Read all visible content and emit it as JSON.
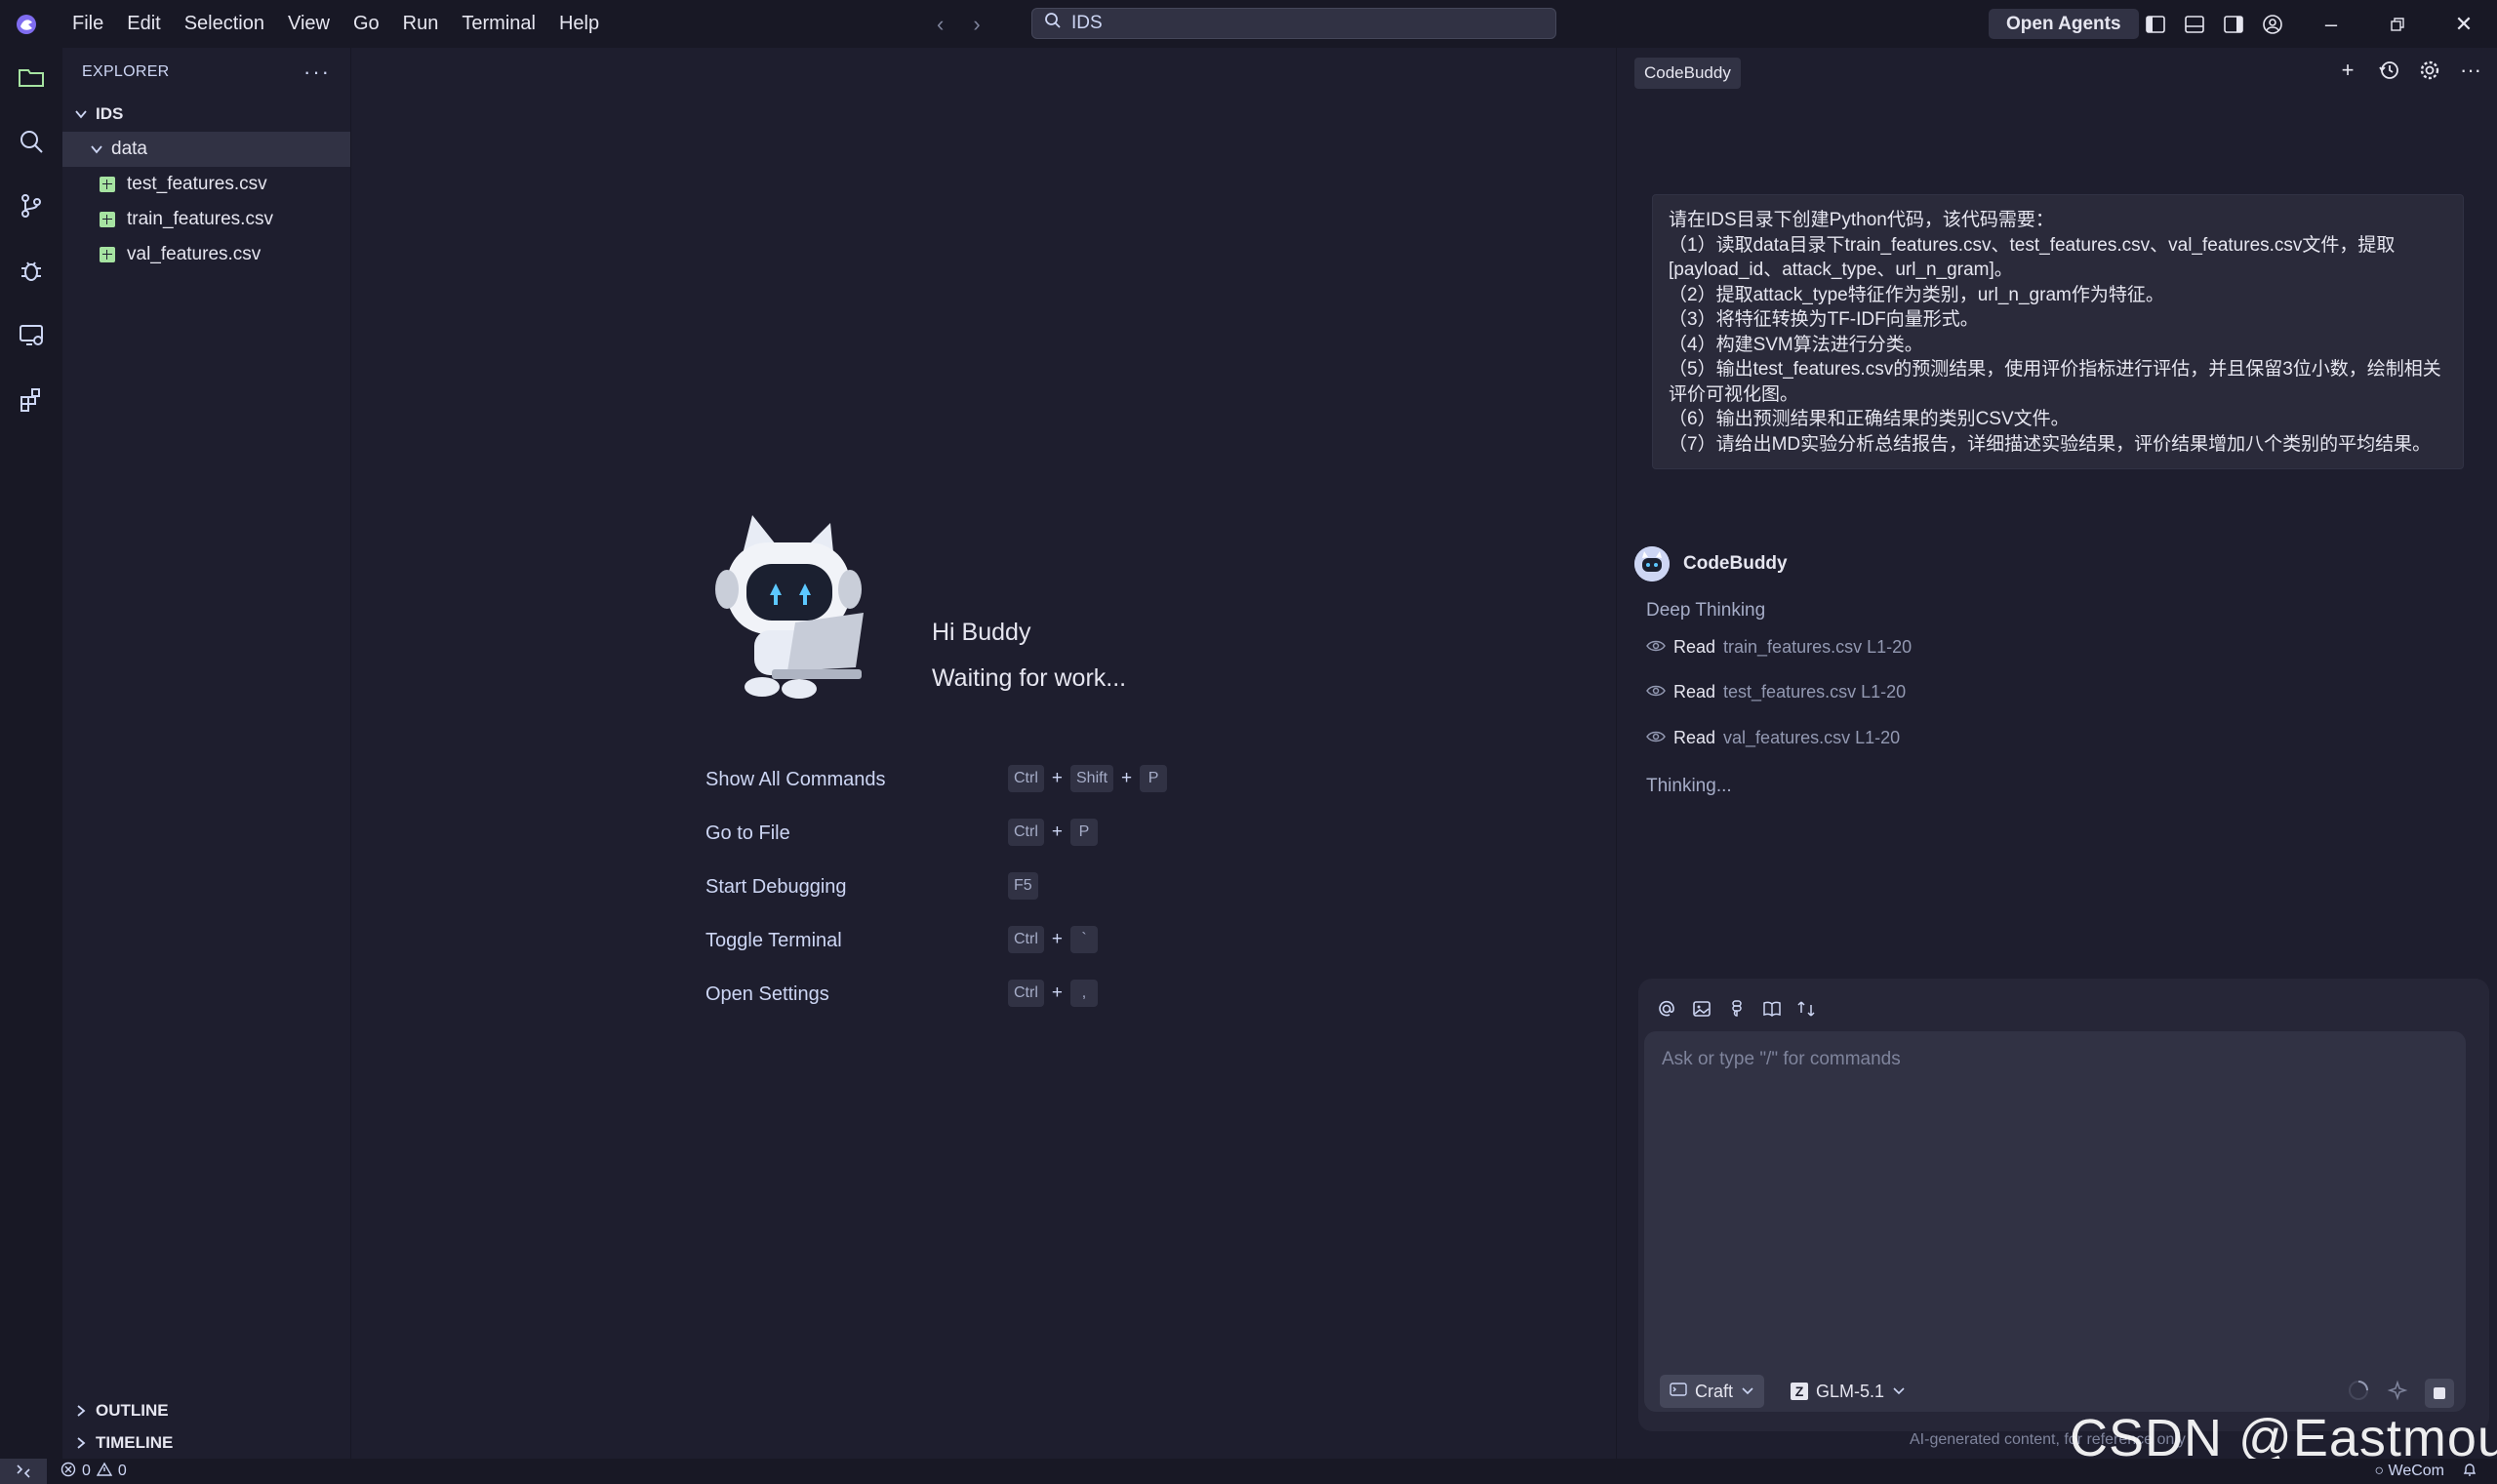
{
  "menu": [
    "File",
    "Edit",
    "Selection",
    "View",
    "Go",
    "Run",
    "Terminal",
    "Help"
  ],
  "search": {
    "text": "IDS"
  },
  "titlebar": {
    "open_agents": "Open Agents"
  },
  "explorer": {
    "title": "EXPLORER",
    "root": "IDS",
    "folder": "data",
    "files": [
      "test_features.csv",
      "train_features.csv",
      "val_features.csv"
    ],
    "outline": "OUTLINE",
    "timeline": "TIMELINE"
  },
  "welcome": {
    "greeting": "Hi Buddy",
    "status": "Waiting for work...",
    "shortcuts": [
      {
        "label": "Show All Commands",
        "keys": [
          "Ctrl",
          "Shift",
          "P"
        ]
      },
      {
        "label": "Go to File",
        "keys": [
          "Ctrl",
          "P"
        ]
      },
      {
        "label": "Start Debugging",
        "keys": [
          "F5"
        ]
      },
      {
        "label": "Toggle Terminal",
        "keys": [
          "Ctrl",
          "`"
        ]
      },
      {
        "label": "Open Settings",
        "keys": [
          "Ctrl",
          ","
        ]
      }
    ]
  },
  "chat": {
    "tab": "CodeBuddy",
    "user_message": [
      "请在IDS目录下创建Python代码，该代码需要：",
      "（1）读取data目录下train_features.csv、test_features.csv、val_features.csv文件，提取[payload_id、attack_type、url_n_gram]。",
      "（2）提取attack_type特征作为类别，url_n_gram作为特征。",
      "（3）将特征转换为TF-IDF向量形式。",
      "（4）构建SVM算法进行分类。",
      "（5）输出test_features.csv的预测结果，使用评价指标进行评估，并且保留3位小数，绘制相关评价可视化图。",
      "（6）输出预测结果和正确结果的类别CSV文件。",
      "（7）请给出MD实验分析总结报告，详细描述实验结果，评价结果增加八个类别的平均结果。"
    ],
    "bot_name": "CodeBuddy",
    "deep_thinking": "Deep Thinking",
    "reads": [
      {
        "verb": "Read",
        "file": "train_features.csv L1-20"
      },
      {
        "verb": "Read",
        "file": "test_features.csv L1-20"
      },
      {
        "verb": "Read",
        "file": "val_features.csv L1-20"
      }
    ],
    "thinking": "Thinking...",
    "input_placeholder": "Ask or type \"/\" for commands",
    "mode": "Craft",
    "model": "GLM-5.1",
    "disclaimer": "AI-generated content, for reference only",
    "watermark": "CSDN @Eastmount"
  },
  "status": {
    "errors": "0",
    "warnings": "0",
    "wecom": "WeCom"
  }
}
